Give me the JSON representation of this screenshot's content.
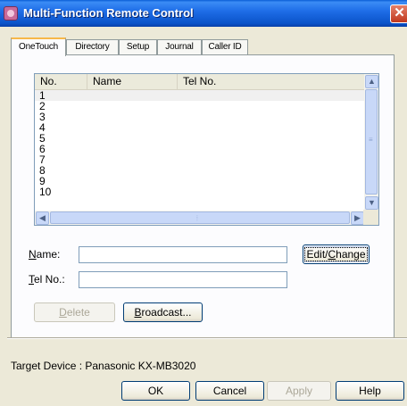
{
  "window": {
    "title": "Multi-Function Remote Control",
    "close_glyph": "✕"
  },
  "tabs": [
    {
      "label": "OneTouch",
      "active": true
    },
    {
      "label": "Directory",
      "active": false
    },
    {
      "label": "Setup",
      "active": false
    },
    {
      "label": "Journal",
      "active": false
    },
    {
      "label": "Caller ID",
      "active": false
    }
  ],
  "list": {
    "columns": [
      "No.",
      "Name",
      "Tel No."
    ],
    "rows": [
      "1",
      "2",
      "3",
      "4",
      "5",
      "6",
      "7",
      "8",
      "9",
      "10"
    ],
    "selected_row": "1"
  },
  "form": {
    "name_label_access": "N",
    "name_label_rest": "ame:",
    "name_value": "",
    "tel_label_access": "T",
    "tel_label_rest": "el No.:",
    "tel_value": ""
  },
  "buttons": {
    "edit_change_pre": "Edit/",
    "edit_change_access": "C",
    "edit_change_post": "hange",
    "delete_access": "D",
    "delete_rest": "elete",
    "broadcast_access": "B",
    "broadcast_rest": "roadcast...",
    "ok": "OK",
    "cancel": "Cancel",
    "apply": "Apply",
    "help": "Help"
  },
  "footer": {
    "target_device": "Target Device : Panasonic KX-MB3020"
  },
  "colors": {
    "titlebar": "#0a5fd6",
    "dialog_bg": "#ece9d8",
    "tab_highlight": "#f7b84a",
    "close_button": "#c0381e"
  },
  "icons": {
    "app": "app-remote-icon",
    "close": "close-icon",
    "scroll_up": "chevron-up-icon",
    "scroll_down": "chevron-down-icon",
    "scroll_left": "chevron-left-icon",
    "scroll_right": "chevron-right-icon"
  }
}
